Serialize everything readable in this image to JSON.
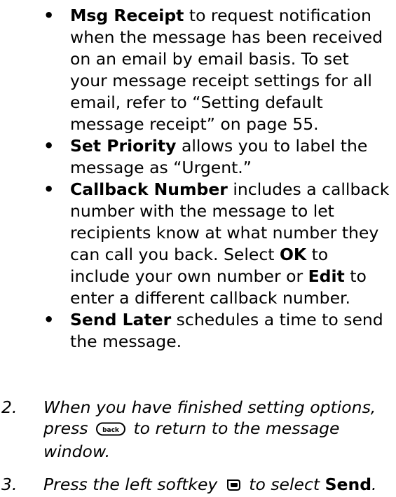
{
  "bullets": [
    {
      "term": "Msg Receipt",
      "text": " to request notification when the message has been received on an email by email basis. To set your message receipt settings for all email, refer to “Setting default message receipt” on page 55."
    },
    {
      "term": "Set Priority",
      "text": " allows you to label the message as “Urgent.”"
    },
    {
      "term": "Callback Number",
      "text": " includes a callback number with the message to let recipients know at what number they can call you back. Select ",
      "ok": "OK",
      "mid": " to include your own number or ",
      "edit": "Edit",
      "tail": " to enter a different callback number."
    },
    {
      "term": "Send Later",
      "text": " schedules a time to send the message."
    }
  ],
  "steps": [
    {
      "num": "2.",
      "before": "When you have finished setting options, press ",
      "icon_name": "back-key-icon",
      "icon_text": "back",
      "after": " to return to the message window."
    },
    {
      "num": "3.",
      "before": "Press the left softkey ",
      "icon_name": "left-softkey-icon",
      "mid": " to select ",
      "term": "Send",
      "end": "."
    }
  ]
}
